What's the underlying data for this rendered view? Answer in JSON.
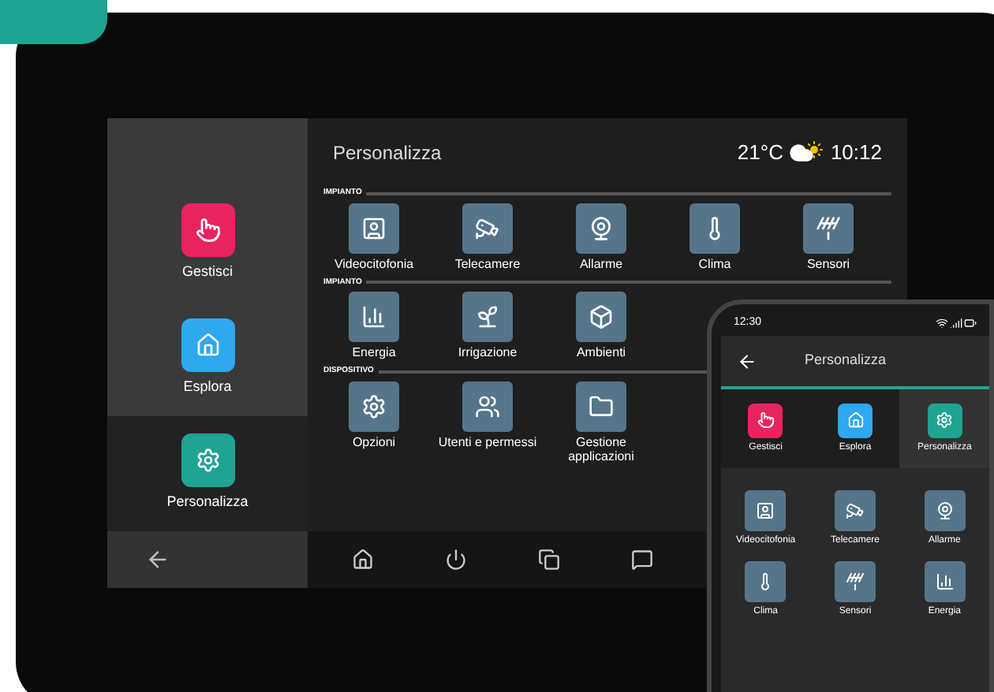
{
  "tablet": {
    "title": "Personalizza",
    "weather": {
      "temperature": "21°C",
      "time": "10:12"
    },
    "sidebar": {
      "items": [
        {
          "label": "Gestisci",
          "color": "#e8245e",
          "selected": false
        },
        {
          "label": "Esplora",
          "color": "#2ea8ee",
          "selected": false
        },
        {
          "label": "Personalizza",
          "color": "#1fa392",
          "selected": true
        }
      ]
    },
    "sections": [
      {
        "label": "IMPIANTO",
        "tiles": [
          "Videocitofonia",
          "Telecamere",
          "Allarme",
          "Clima",
          "Sensori"
        ]
      },
      {
        "label": "IMPIANTO",
        "tiles": [
          "Energia",
          "Irrigazione",
          "Ambienti"
        ]
      },
      {
        "label": "DISPOSITIVO",
        "tiles": [
          "Opzioni",
          "Utenti e permessi",
          "Gestione applicazioni"
        ]
      }
    ]
  },
  "phone": {
    "status_time": "12:30",
    "title": "Personalizza",
    "nav": [
      {
        "label": "Gestisci",
        "color": "#e8245e",
        "selected": false
      },
      {
        "label": "Esplora",
        "color": "#2ea8ee",
        "selected": false
      },
      {
        "label": "Personalizza",
        "color": "#1fa392",
        "selected": true
      }
    ],
    "tiles": [
      "Videocitofonia",
      "Telecamere",
      "Allarme",
      "Clima",
      "Sensori",
      "Energia"
    ]
  }
}
